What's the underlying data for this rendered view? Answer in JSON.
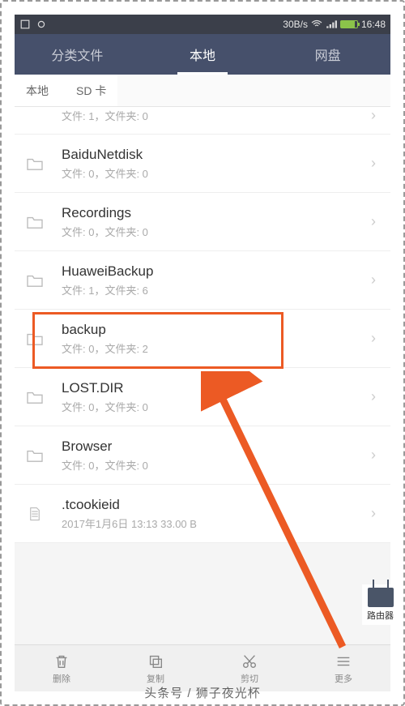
{
  "statusbar": {
    "speed": "30B/s",
    "time": "16:48"
  },
  "tabs": {
    "category": "分类文件",
    "local": "本地",
    "cloud": "网盘"
  },
  "breadcrumb": {
    "items": [
      "本地",
      "SD 卡"
    ]
  },
  "partial_row": {
    "subtitle": "文件: 1，文件夹: 0"
  },
  "items": [
    {
      "name": "BaiduNetdisk",
      "subtitle": "文件: 0，文件夹: 0",
      "type": "folder"
    },
    {
      "name": "Recordings",
      "subtitle": "文件: 0，文件夹: 0",
      "type": "folder"
    },
    {
      "name": "HuaweiBackup",
      "subtitle": "文件: 1，文件夹: 6",
      "type": "folder",
      "highlighted": true
    },
    {
      "name": "backup",
      "subtitle": "文件: 0，文件夹: 2",
      "type": "folder"
    },
    {
      "name": "LOST.DIR",
      "subtitle": "文件: 0，文件夹: 0",
      "type": "folder"
    },
    {
      "name": "Browser",
      "subtitle": "文件: 0，文件夹: 0",
      "type": "folder"
    },
    {
      "name": ".tcookieid",
      "subtitle": "2017年1月6日 13:13 33.00 B",
      "type": "file"
    }
  ],
  "bottombar": {
    "delete": "删除",
    "copy": "复制",
    "cut": "剪切",
    "more": "更多"
  },
  "watermarks": {
    "router": "路由器",
    "credit": "头条号 / 狮子夜光杯"
  },
  "highlight_color": "#ec5a24"
}
